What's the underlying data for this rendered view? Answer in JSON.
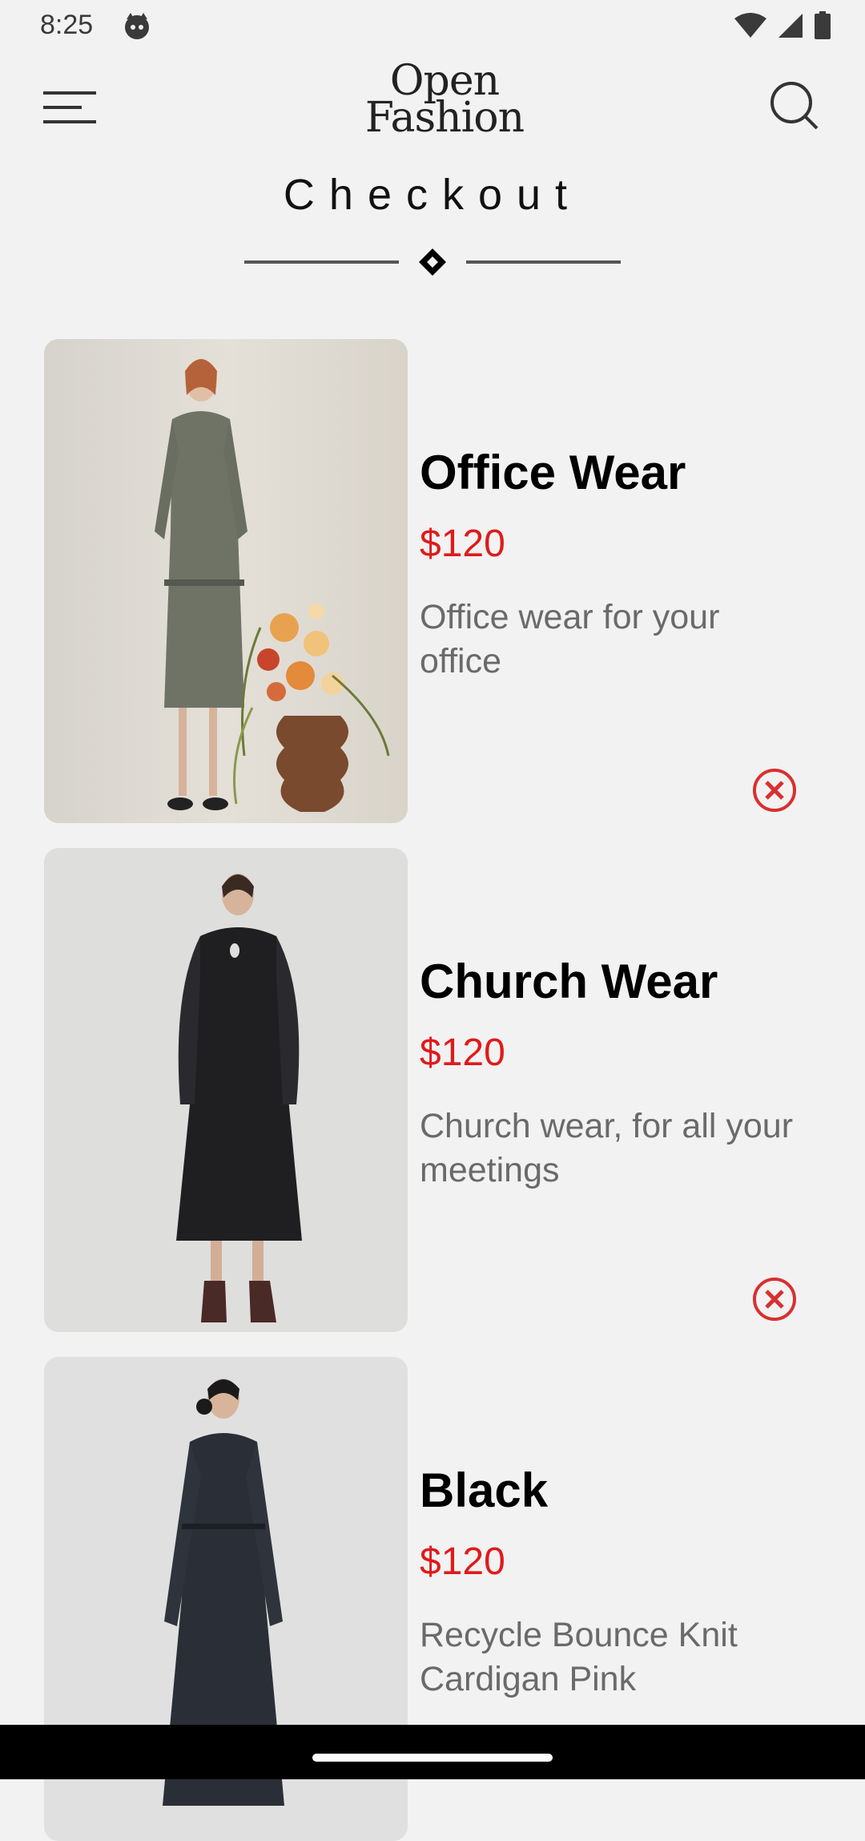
{
  "status": {
    "time": "8:25",
    "app_icon": "cat-face-icon",
    "icons": [
      "wifi-icon",
      "signal-icon",
      "battery-icon"
    ]
  },
  "header": {
    "menu_icon": "hamburger-menu-icon",
    "brand_line1": "Open",
    "brand_line2": "Fashion",
    "search_icon": "search-icon"
  },
  "page": {
    "title": "Checkout"
  },
  "items": [
    {
      "title": "Office Wear",
      "price": "$120",
      "description": "Office wear for your office",
      "remove_icon": "remove-circle-x-icon"
    },
    {
      "title": "Church Wear",
      "price": "$120",
      "description": "Church wear, for all your meetings",
      "remove_icon": "remove-circle-x-icon"
    },
    {
      "title": "Black",
      "price": "$120",
      "description": "Recycle Bounce Knit Cardigan Pink"
    }
  ],
  "colors": {
    "background": "#f2f2f2",
    "price": "#e01a1a",
    "description": "#6a6a6a",
    "remove_icon": "#d93030"
  }
}
